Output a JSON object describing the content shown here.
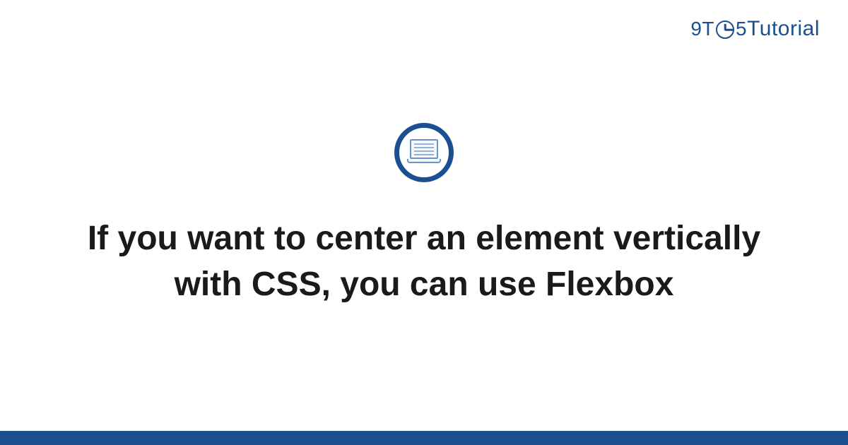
{
  "brand": {
    "prefix": "9T",
    "middle": "5",
    "suffix": "Tutorial"
  },
  "icon": "laptop-icon",
  "title": "If you want to center an element vertically with CSS, you can use Flexbox",
  "colors": {
    "primary": "#1b4f8f",
    "iconStroke": "#6a93c8",
    "text": "#1a1a1a"
  }
}
